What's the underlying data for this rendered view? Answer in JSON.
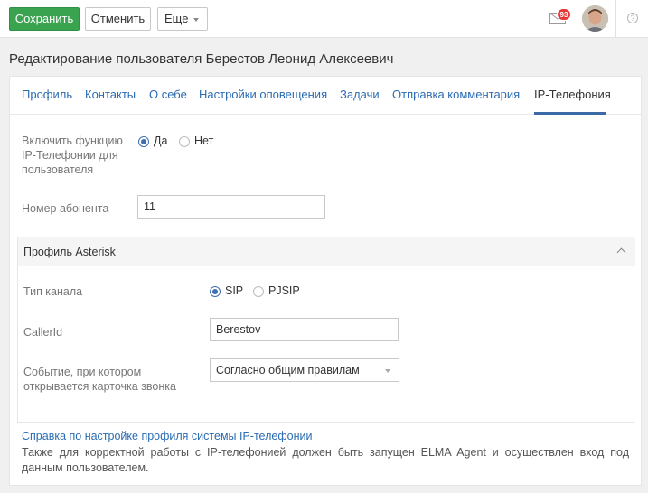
{
  "toolbar": {
    "save_label": "Сохранить",
    "cancel_label": "Отменить",
    "more_label": "Еще",
    "mail_badge": "93",
    "help_label": "?"
  },
  "page": {
    "title": "Редактирование пользователя Берестов Леонид Алексеевич"
  },
  "tabs": [
    {
      "label": "Профиль",
      "active": false
    },
    {
      "label": "Контакты",
      "active": false
    },
    {
      "label": "О себе",
      "active": false
    },
    {
      "label": "Настройки оповещения",
      "active": false
    },
    {
      "label": "Задачи",
      "active": false
    },
    {
      "label": "Отправка комментария",
      "active": false
    },
    {
      "label": "IP-Телефония",
      "active": true
    }
  ],
  "form": {
    "enable_label": "Включить функцию IP-Телефонии для пользователя",
    "enable_yes": "Да",
    "enable_no": "Нет",
    "enable_value": "Да",
    "subscriber_label": "Номер абонента",
    "subscriber_value": "11"
  },
  "asterisk": {
    "title": "Профиль Asterisk",
    "channel_label": "Тип канала",
    "channel_sip": "SIP",
    "channel_pjsip": "PJSIP",
    "channel_value": "SIP",
    "callerid_label": "CallerId",
    "callerid_value": "Berestov",
    "event_label": "Событие, при котором открывается карточка звонка",
    "event_value": "Согласно общим правилам"
  },
  "footer": {
    "link": "Справка по настройке профиля системы IP-телефонии",
    "text": "Также для корректной работы с IP-телефонией должен быть запущен ELMA Agent и осуществлен вход под данным пользователем."
  },
  "colors": {
    "accent": "#3aa350",
    "link": "#2b6cb3",
    "badge": "#e53935"
  }
}
